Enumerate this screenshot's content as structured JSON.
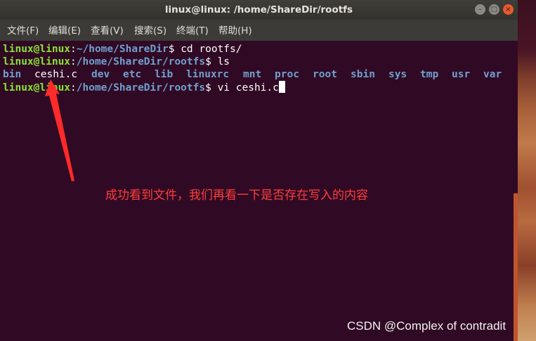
{
  "window": {
    "title": "linux@linux: /home/ShareDir/rootfs",
    "controls": [
      "minimize-icon",
      "maximize-icon",
      "close-icon"
    ]
  },
  "menubar": {
    "items": [
      "文件(F)",
      "编辑(E)",
      "查看(V)",
      "搜索(S)",
      "终端(T)",
      "帮助(H)"
    ]
  },
  "terminal": {
    "lines": [
      {
        "user": "linux@linux",
        "path": "~/home/ShareDir",
        "command": "cd rootfs/"
      },
      {
        "user": "linux@linux",
        "path": "/home/ShareDir/rootfs",
        "command": "ls"
      },
      {
        "user": "linux@linux",
        "path": "/home/ShareDir/rootfs",
        "command": "vi ceshi.c"
      }
    ],
    "ls_output": [
      "bin",
      "ceshi.c",
      "dev",
      "etc",
      "lib",
      "linuxrc",
      "mnt",
      "proc",
      "root",
      "sbin",
      "sys",
      "tmp",
      "usr",
      "var"
    ],
    "colors": {
      "prompt": "#8ae234",
      "directory": "#729fcf",
      "file": "#ffffff",
      "background": "#300a24"
    }
  },
  "annotation": {
    "text": "成功看到文件，我们再看一下是否存在写入的内容",
    "color": "#ff3d3d"
  },
  "watermark": "CSDN @Complex of contradit"
}
